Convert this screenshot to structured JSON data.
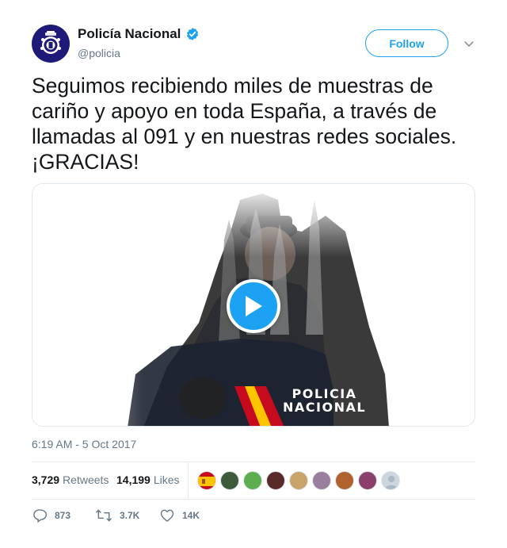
{
  "author": {
    "name": "Policía Nacional",
    "handle": "@policia",
    "verified": true
  },
  "follow_label": "Follow",
  "tweet": {
    "text": "Seguimos recibiendo miles de muestras de cariño y apoyo en toda España, a través de llamadas al 091 y en nuestras redes sociales. ¡GRACIAS!"
  },
  "media": {
    "logo_line1": "POLICIA",
    "logo_line2": "NACIONAL"
  },
  "timestamp": "6:19 AM - 5 Oct 2017",
  "stats": {
    "retweets_count": "3,729",
    "retweets_label": "Retweets",
    "likes_count": "14,199",
    "likes_label": "Likes"
  },
  "actions": {
    "replies": "873",
    "retweets": "3.7K",
    "likes": "14K"
  },
  "colors": {
    "accent": "#1da1f2",
    "text": "#14171a",
    "muted": "#657786",
    "avatar_bg": "#1f1a78"
  }
}
